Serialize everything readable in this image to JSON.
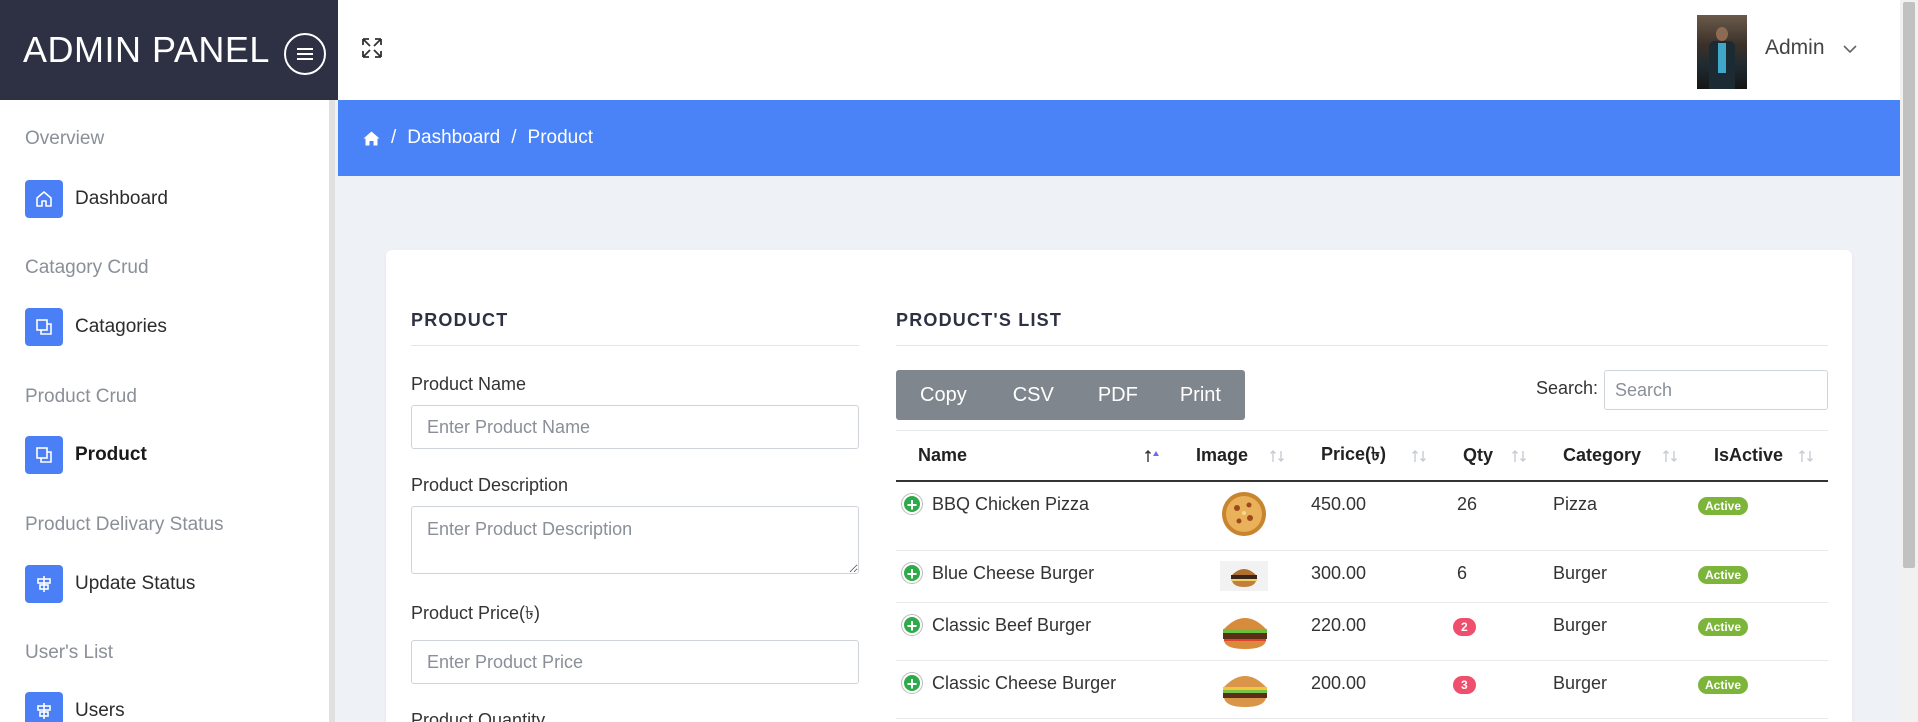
{
  "brand": {
    "title": "ADMIN PANEL"
  },
  "sidebar": {
    "sections": [
      {
        "label": "Overview",
        "item": {
          "label": "Dashboard",
          "icon": "home-icon",
          "active": false
        }
      },
      {
        "label": "Catagory Crud",
        "item": {
          "label": "Catagories",
          "icon": "copy-icon",
          "active": false
        }
      },
      {
        "label": "Product Crud",
        "item": {
          "label": "Product",
          "icon": "copy-icon",
          "active": true
        }
      },
      {
        "label": "Product Delivary Status",
        "item": {
          "label": "Update Status",
          "icon": "sliders-icon",
          "active": false
        }
      },
      {
        "label": "User's List",
        "item": {
          "label": "Users",
          "icon": "sliders-icon",
          "active": false
        }
      }
    ]
  },
  "header": {
    "user_name": "Admin"
  },
  "breadcrumb": {
    "items": [
      "Dashboard",
      "Product"
    ]
  },
  "form": {
    "title": "PRODUCT",
    "name_label": "Product Name",
    "name_placeholder": "Enter Product Name",
    "description_label": "Product Description",
    "description_placeholder": "Enter Product Description",
    "price_label": "Product Price(৳)",
    "price_placeholder": "Enter Product Price",
    "quantity_label": "Product Quantity"
  },
  "list": {
    "title": "PRODUCT'S LIST",
    "buttons": [
      "Copy",
      "CSV",
      "PDF",
      "Print"
    ],
    "search_label": "Search:",
    "search_placeholder": "Search",
    "columns": [
      "Name",
      "Image",
      "Price(৳)",
      "Qty",
      "Category",
      "IsActive"
    ],
    "rows": [
      {
        "name": "BBQ Chicken Pizza",
        "image": "pizza",
        "price": "450.00",
        "qty": "26",
        "qty_badge": false,
        "category": "Pizza",
        "status": "Active"
      },
      {
        "name": "Blue Cheese Burger",
        "image": "burger-small",
        "price": "300.00",
        "qty": "6",
        "qty_badge": false,
        "category": "Burger",
        "status": "Active"
      },
      {
        "name": "Classic Beef Burger",
        "image": "burger",
        "price": "220.00",
        "qty": "2",
        "qty_badge": true,
        "category": "Burger",
        "status": "Active"
      },
      {
        "name": "Classic Cheese Burger",
        "image": "burger",
        "price": "200.00",
        "qty": "3",
        "qty_badge": true,
        "category": "Burger",
        "status": "Active"
      }
    ]
  },
  "colors": {
    "sidebar_dark": "#2d3143",
    "accent": "#4a82f7",
    "active_badge": "#7db43a",
    "qty_badge": "#ef4f6d",
    "button_gray": "#7f868e"
  }
}
